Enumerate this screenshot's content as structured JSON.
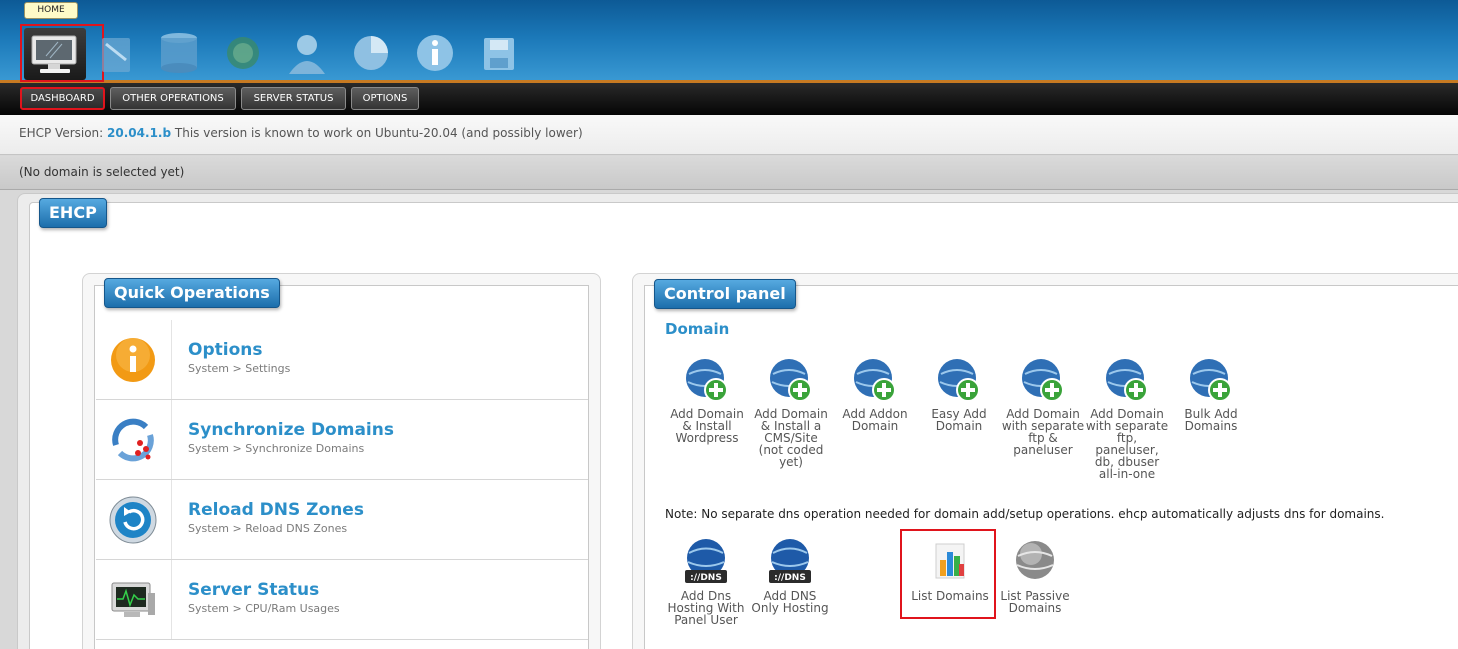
{
  "header": {
    "home_tooltip": "HOME",
    "top_icons": [
      "home-monitor-icon",
      "edit-document-icon",
      "mysql-database-icon",
      "ftp-globe-icon",
      "user-icon",
      "pie-chart-icon",
      "info-icon",
      "save-disk-icon"
    ]
  },
  "nav": {
    "dashboard": "DASHBOARD",
    "other_operations": "OTHER OPERATIONS",
    "server_status": "SERVER STATUS",
    "options": "OPTIONS"
  },
  "version": {
    "label": "EHCP Version:",
    "number": "20.04.1.b",
    "note": "This version is known to work on Ubuntu-20.04 (and possibly lower)"
  },
  "domain_status": "(No domain is selected yet)",
  "main_title": "EHCP",
  "quick_ops": {
    "title": "Quick Operations",
    "items": [
      {
        "title": "Options",
        "sub": "System > Settings",
        "icon": "info-icon"
      },
      {
        "title": "Synchronize Domains",
        "sub": "System > Synchronize Domains",
        "icon": "sync-icon"
      },
      {
        "title": "Reload DNS Zones",
        "sub": "System > Reload DNS Zones",
        "icon": "reload-icon"
      },
      {
        "title": "Server Status",
        "sub": "System > CPU/Ram Usages",
        "icon": "monitor-icon"
      }
    ]
  },
  "control_panel": {
    "title": "Control panel",
    "section": "Domain",
    "domain_items": [
      {
        "lines": [
          "Add Domain",
          "& Install",
          "Wordpress"
        ]
      },
      {
        "lines": [
          "Add Domain",
          "& Install a",
          "CMS/Site",
          "(not coded",
          "yet)"
        ]
      },
      {
        "lines": [
          "Add Addon",
          "Domain"
        ]
      },
      {
        "lines": [
          "Easy Add",
          "Domain"
        ]
      },
      {
        "lines": [
          "Add Domain",
          "with separate",
          "ftp &",
          "paneluser"
        ]
      },
      {
        "lines": [
          "Add Domain",
          "with separate",
          "ftp,",
          "paneluser,",
          "db, dbuser",
          "all-in-one"
        ]
      },
      {
        "lines": [
          "Bulk Add",
          "Domains"
        ]
      }
    ],
    "note": "Note: No separate dns operation needed for domain add/setup operations. ehcp automatically adjusts dns for domains.",
    "dns_items": [
      {
        "lines": [
          "Add Dns",
          "Hosting With",
          "Panel User"
        ],
        "icon": "dns-globe-icon"
      },
      {
        "lines": [
          "Add DNS",
          "Only Hosting"
        ],
        "icon": "dns-globe-icon"
      },
      {
        "lines": [
          "List Domains"
        ],
        "icon": "bar-chart-icon"
      },
      {
        "lines": [
          "List Passive",
          "Domains"
        ],
        "icon": "grey-globe-icon"
      }
    ],
    "dns_badge": "://DNS"
  }
}
